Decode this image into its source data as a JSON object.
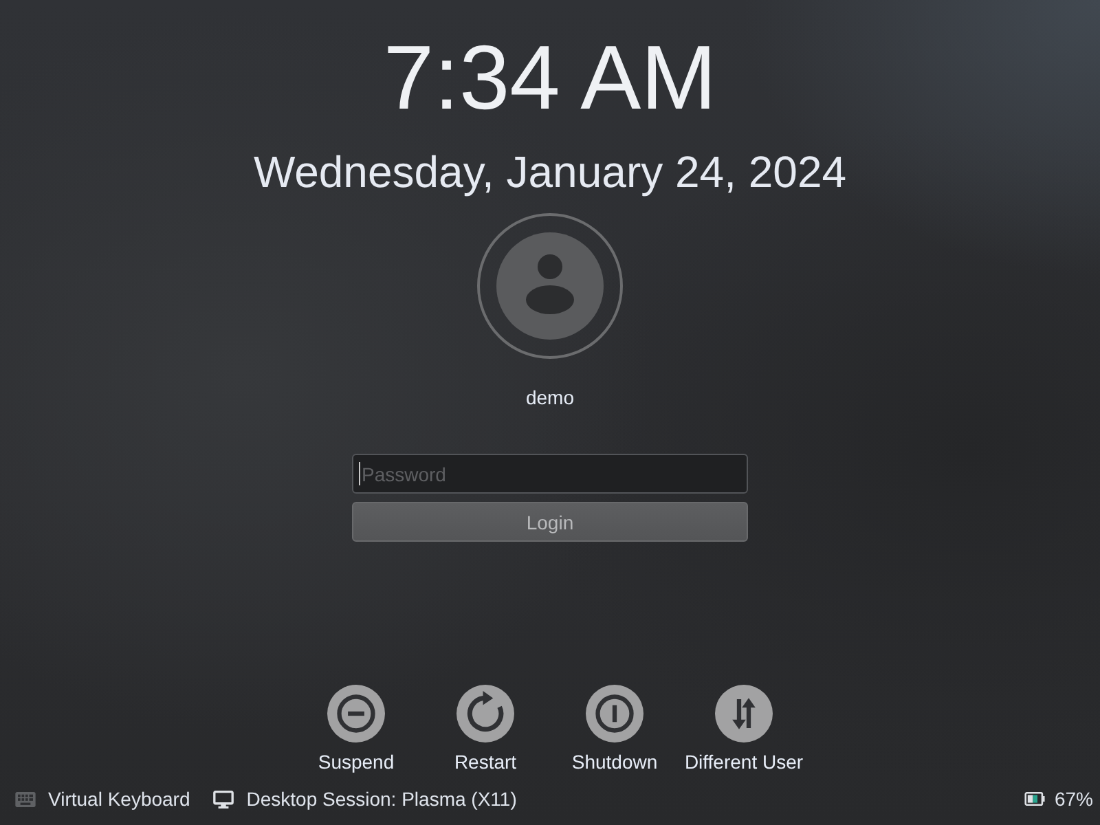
{
  "clock": {
    "time": "7:34 AM",
    "date": "Wednesday, January 24, 2024"
  },
  "user": {
    "name": "demo"
  },
  "login_form": {
    "password": {
      "placeholder": "Password"
    },
    "button": "Login"
  },
  "actions": [
    {
      "kind": "suspend",
      "label": "Suspend"
    },
    {
      "kind": "restart",
      "label": "Restart"
    },
    {
      "kind": "shutdown",
      "label": "Shutdown"
    },
    {
      "kind": "switch_user",
      "label": "Different User"
    }
  ],
  "footer": {
    "items": [
      {
        "kind": "keyboard",
        "label": "Virtual Keyboard"
      },
      {
        "kind": "session",
        "label": "Desktop Session: Plasma (X11)"
      }
    ],
    "battery": {
      "reading": "67%"
    }
  }
}
